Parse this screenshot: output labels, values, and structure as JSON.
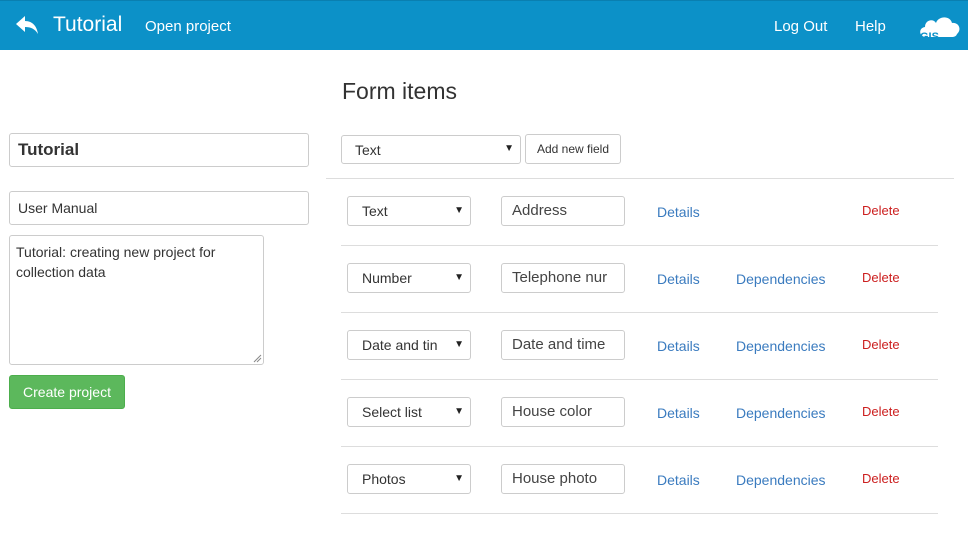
{
  "header": {
    "title": "Tutorial",
    "open_project": "Open project",
    "logout": "Log Out",
    "help": "Help",
    "logo_text": "GIS",
    "color": "#0c91c8"
  },
  "project": {
    "name": "Tutorial",
    "subtitle": "User Manual",
    "description": "Tutorial: creating new project for collection data",
    "create_label": "Create project"
  },
  "form": {
    "title": "Form items",
    "new_type": "Text",
    "add_label": "Add new field",
    "items": [
      {
        "type": "Text",
        "name": "Address",
        "details": "Details",
        "dependencies": "",
        "delete": "Delete"
      },
      {
        "type": "Number",
        "name": "Telephone nur",
        "details": "Details",
        "dependencies": "Dependencies",
        "delete": "Delete"
      },
      {
        "type": "Date and tin",
        "name": "Date and time",
        "details": "Details",
        "dependencies": "Dependencies",
        "delete": "Delete"
      },
      {
        "type": "Select list",
        "name": "House color",
        "details": "Details",
        "dependencies": "Dependencies",
        "delete": "Delete"
      },
      {
        "type": "Photos",
        "name": "House photo",
        "details": "Details",
        "dependencies": "Dependencies",
        "delete": "Delete"
      }
    ]
  }
}
